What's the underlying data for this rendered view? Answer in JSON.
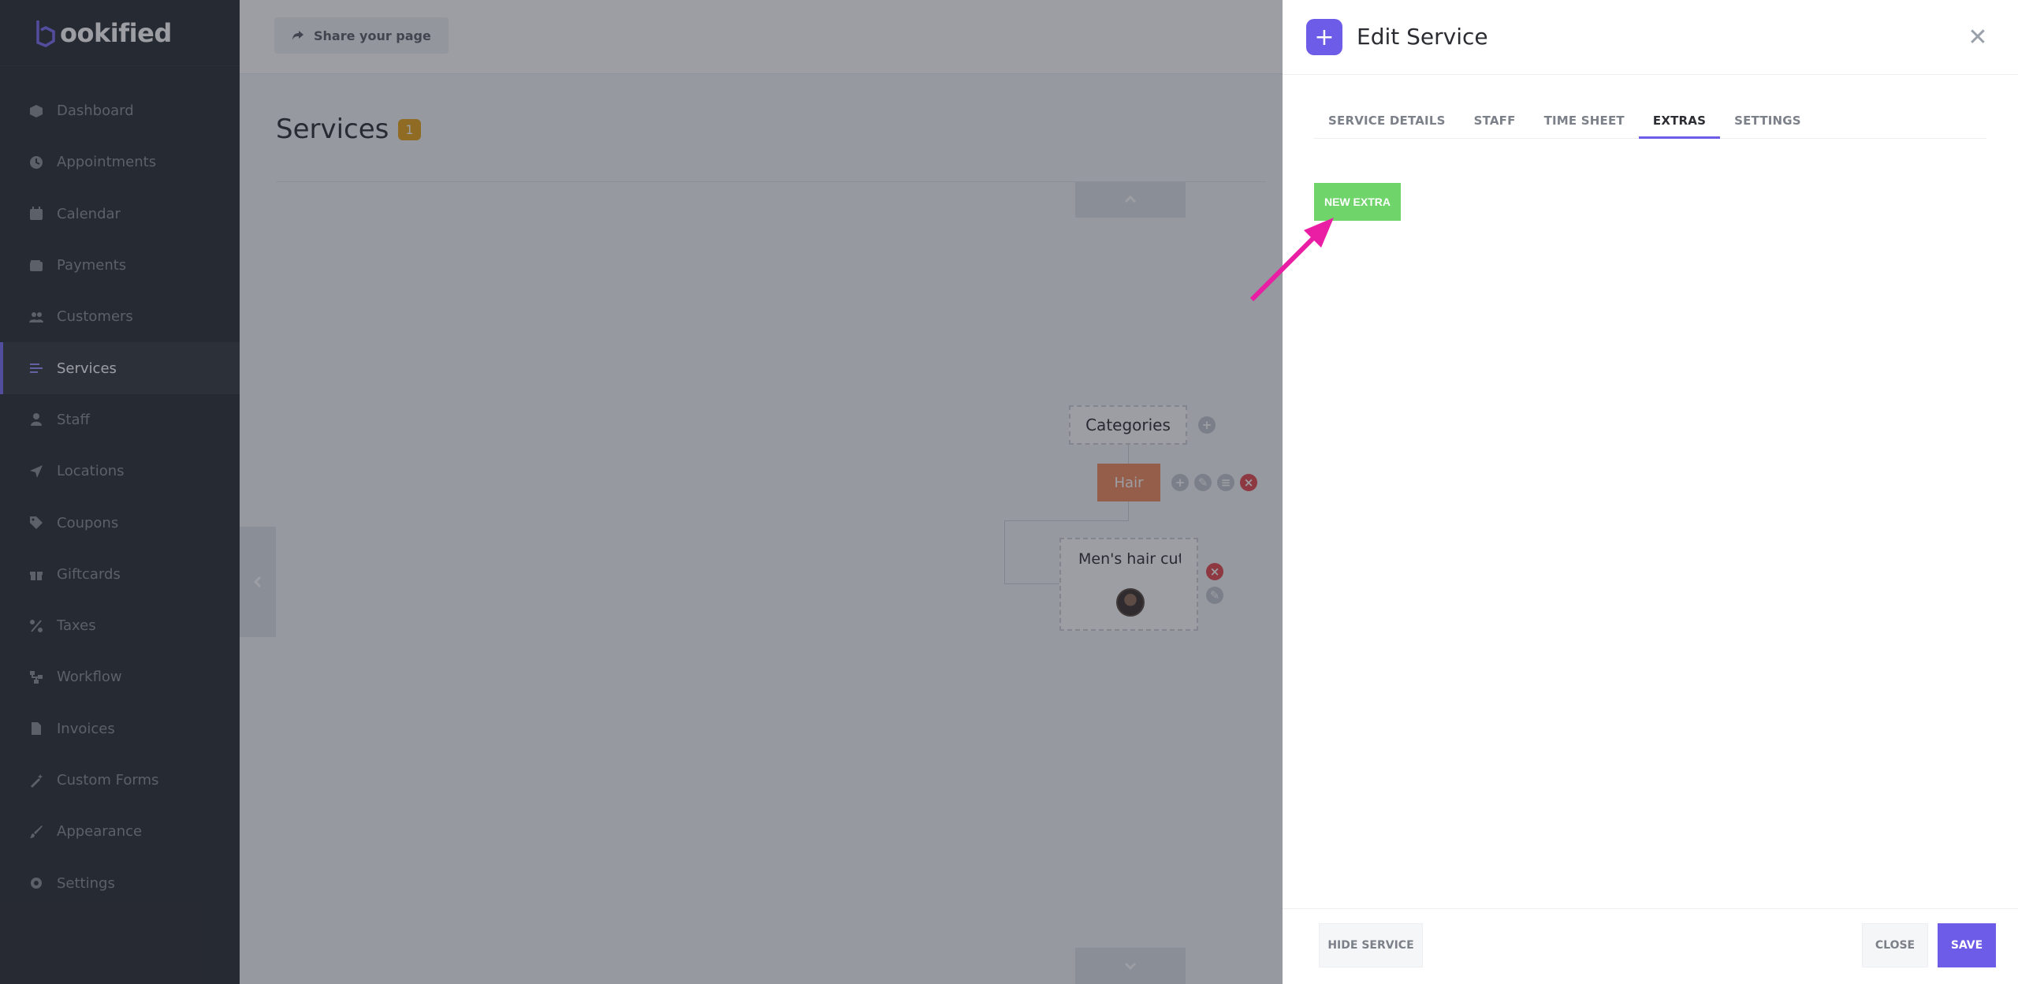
{
  "brand": {
    "name": "ookified"
  },
  "sidebar": {
    "items": [
      {
        "label": "Dashboard",
        "icon": "cube-icon"
      },
      {
        "label": "Appointments",
        "icon": "clock-icon"
      },
      {
        "label": "Calendar",
        "icon": "calendar-icon"
      },
      {
        "label": "Payments",
        "icon": "wallet-icon"
      },
      {
        "label": "Customers",
        "icon": "users-icon"
      },
      {
        "label": "Services",
        "icon": "list-icon",
        "active": true
      },
      {
        "label": "Staff",
        "icon": "user-icon"
      },
      {
        "label": "Locations",
        "icon": "location-arrow-icon"
      },
      {
        "label": "Coupons",
        "icon": "tags-icon"
      },
      {
        "label": "Giftcards",
        "icon": "gift-icon"
      },
      {
        "label": "Taxes",
        "icon": "percent-icon"
      },
      {
        "label": "Workflow",
        "icon": "sitemap-icon"
      },
      {
        "label": "Invoices",
        "icon": "file-icon"
      },
      {
        "label": "Custom Forms",
        "icon": "magic-icon"
      },
      {
        "label": "Appearance",
        "icon": "brush-icon"
      },
      {
        "label": "Settings",
        "icon": "gear-icon"
      }
    ]
  },
  "topbar": {
    "share_label": "Share your page"
  },
  "page": {
    "title": "Services",
    "count": "1"
  },
  "tree": {
    "categories_label": "Categories",
    "category_name": "Hair",
    "service_name": "Men's hair cut"
  },
  "panel": {
    "title": "Edit Service",
    "tabs": [
      "SERVICE DETAILS",
      "STAFF",
      "TIME SHEET",
      "EXTRAS",
      "SETTINGS"
    ],
    "active_tab": "EXTRAS",
    "new_extra_label": "NEW EXTRA",
    "hide_label": "HIDE SERVICE",
    "close_label": "CLOSE",
    "save_label": "SAVE"
  },
  "colors": {
    "accent": "#6c5ce7",
    "success": "#6fd46a",
    "annotation_arrow": "#e91ea4",
    "category": "#f08a5d"
  }
}
